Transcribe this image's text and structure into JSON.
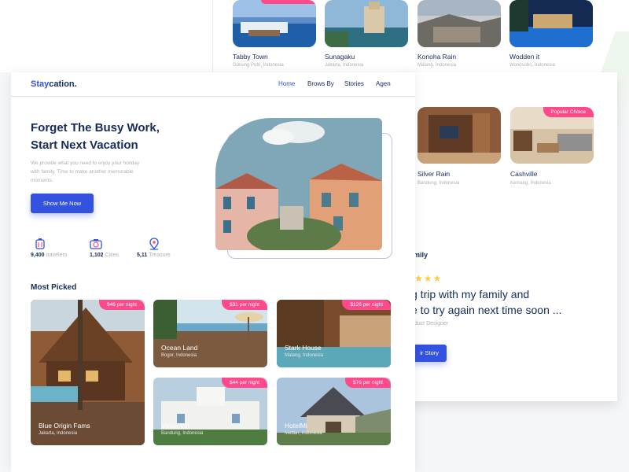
{
  "top_cards": [
    {
      "name": "Tabby Town",
      "location": "Gunung Putri, Indonesia",
      "badge": ""
    },
    {
      "name": "Sunagaku",
      "location": "Jakarta, Indonesia",
      "badge": ""
    },
    {
      "name": "Konoha Rain",
      "location": "Malang, Indonesia",
      "badge": ""
    },
    {
      "name": "Wodden it",
      "location": "Wonosobo, Indonesia",
      "badge": ""
    }
  ],
  "back_cards": [
    {
      "name": "Silver Rain",
      "location": "Bandung, Indonesia",
      "badge": ""
    },
    {
      "name": "Cashville",
      "location": "Kemang, Indonesia",
      "badge": "Popular Choice"
    }
  ],
  "testimonial": {
    "heading_fragment": "mily",
    "stars": "★★★",
    "line1": "g trip with my family and",
    "line2": "e to try again next time soon ...",
    "role": "oduct Designer",
    "button": "ir Story"
  },
  "header": {
    "brand_main": "Stay",
    "brand_accent": "cation.",
    "nav": [
      "Home",
      "Brows By",
      "Stories",
      "Agen"
    ],
    "active_nav": "Home"
  },
  "hero": {
    "title_line1": "Forget The Busy Work,",
    "title_line2": "Start Next Vacation",
    "description": "We provide what you need to enjoy your holiday with family. Time to make another memorable moments.",
    "cta": "Show Me Now"
  },
  "stats": [
    {
      "icon": "traveler-icon",
      "value": "9,400",
      "label": "travelers"
    },
    {
      "icon": "camera-icon",
      "value": "1,102",
      "label": "Cities"
    },
    {
      "icon": "location-pin-icon",
      "value": "5,11",
      "label": "Treasure"
    }
  ],
  "most_picked": {
    "title": "Most Picked",
    "items": [
      {
        "name": "Blue Origin Fams",
        "location": "Jakarta, Indonesia",
        "price": "$46 per night"
      },
      {
        "name": "Ocean Land",
        "location": "Bogor, Indonesia",
        "price": "$31 per night"
      },
      {
        "name": "Stark House",
        "location": "Malang, Indonesia",
        "price": "$126 per night"
      },
      {
        "name": "Vinna Vill",
        "location": "Bandung, Indonesia",
        "price": "$44 per night"
      },
      {
        "name": "HotelMi",
        "location": "Medan, Indonesia",
        "price": "$76 per night"
      }
    ]
  },
  "colors": {
    "primary": "#3252df",
    "navy": "#152c5b",
    "badge": "#ff498b",
    "muted": "#b0b0b0"
  }
}
